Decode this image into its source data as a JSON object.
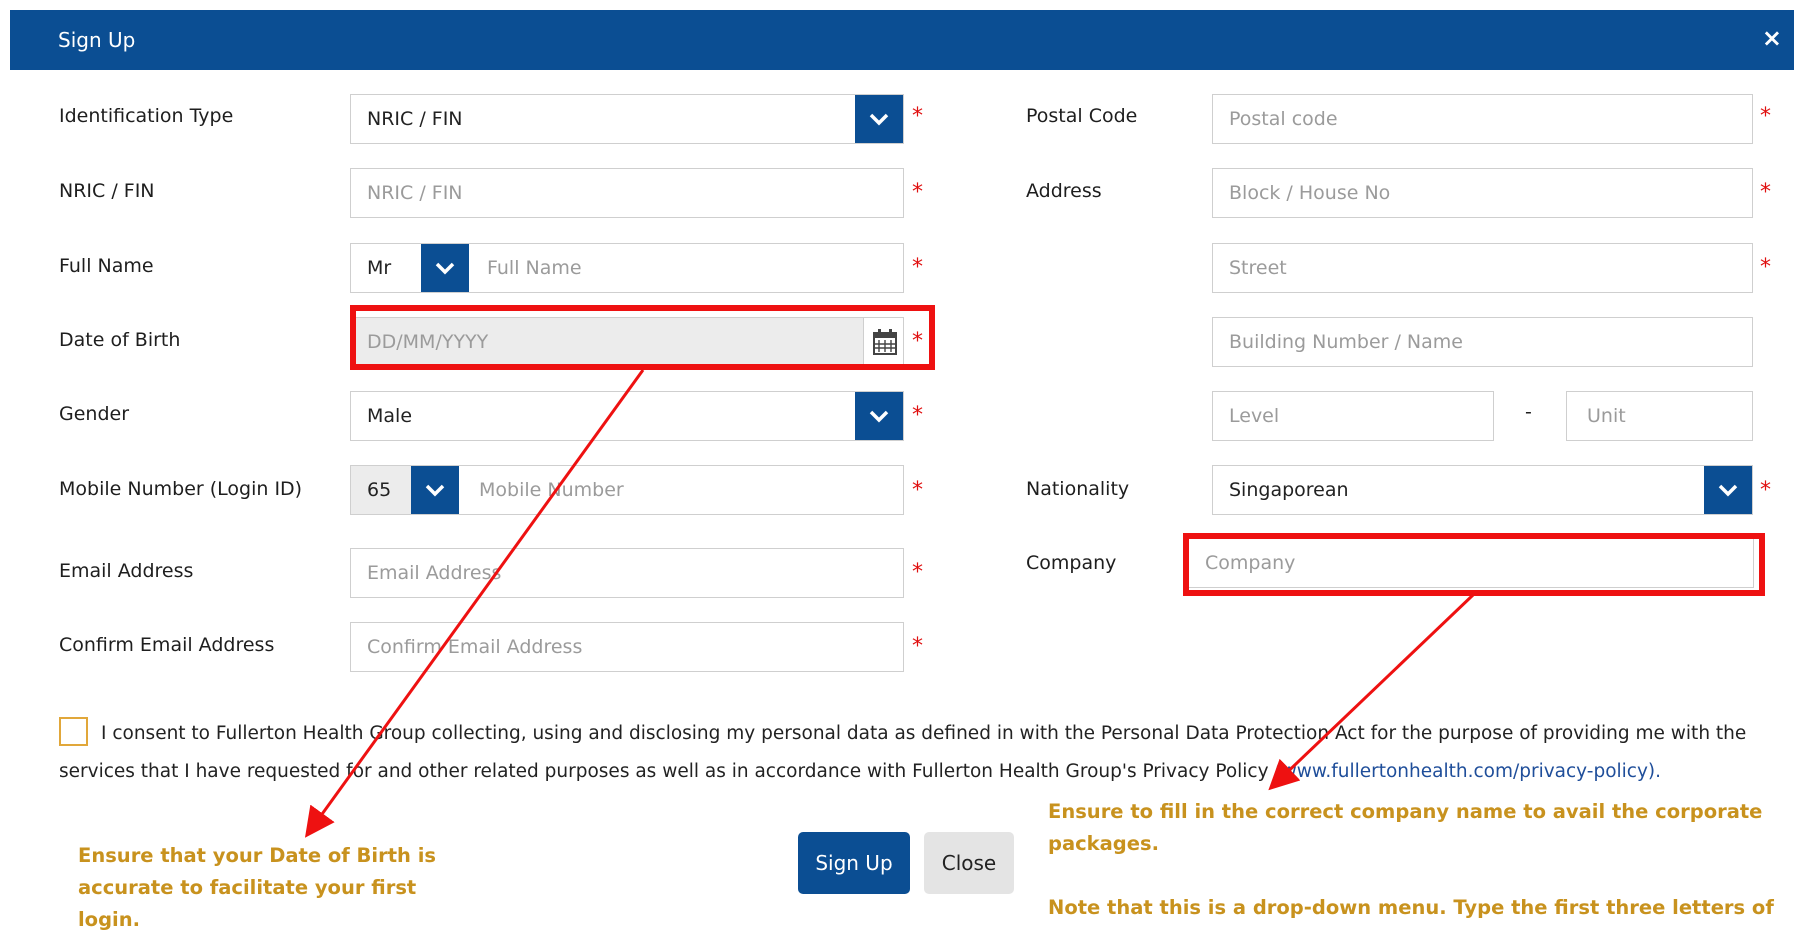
{
  "header": {
    "title": "Sign Up",
    "close_label": "×"
  },
  "left": {
    "id_type": {
      "label": "Identification Type",
      "value": "NRIC / FIN"
    },
    "nric": {
      "label": "NRIC / FIN",
      "placeholder": "NRIC / FIN"
    },
    "full_name": {
      "label": "Full Name",
      "salutation": "Mr",
      "placeholder": "Full Name"
    },
    "dob": {
      "label": "Date of Birth",
      "placeholder": "DD/MM/YYYY"
    },
    "gender": {
      "label": "Gender",
      "value": "Male"
    },
    "mobile": {
      "label": "Mobile Number (Login ID)",
      "code": "65",
      "placeholder": "Mobile Number"
    },
    "email": {
      "label": "Email Address",
      "placeholder": "Email Address"
    },
    "confirm_email": {
      "label": "Confirm Email Address",
      "placeholder": "Confirm Email Address"
    }
  },
  "right": {
    "postal": {
      "label": "Postal Code",
      "placeholder": "Postal code"
    },
    "address": {
      "label": "Address",
      "block_placeholder": "Block / House No",
      "street_placeholder": "Street",
      "building_placeholder": "Building Number / Name",
      "level_placeholder": "Level",
      "separator": "-",
      "unit_placeholder": "Unit"
    },
    "nationality": {
      "label": "Nationality",
      "value": "Singaporean"
    },
    "company": {
      "label": "Company",
      "placeholder": "Company"
    }
  },
  "required_mark": "*",
  "consent": {
    "text": "I consent to Fullerton Health Group collecting, using and disclosing my personal data as defined in with the Personal Data Protection Act for the purpose of providing me with the services that I have requested for and other related purposes as well as in accordance with Fullerton Health Group's Privacy Policy ",
    "link": "(www.fullertonhealth.com/privacy-policy)."
  },
  "buttons": {
    "signup": "Sign Up",
    "close": "Close"
  },
  "notes": {
    "dob": "Ensure that your Date of Birth is accurate to facilitate your first login.",
    "company_1": "Ensure to fill in the correct company name to avail the corporate packages.",
    "company_2": "Note that this is a drop-down menu. Type the first three letters of"
  },
  "colors": {
    "header": "#0b4e93",
    "required": "#e01010",
    "highlight": "#ee1111",
    "note": "#c8921e",
    "link": "#1f4e9a"
  }
}
